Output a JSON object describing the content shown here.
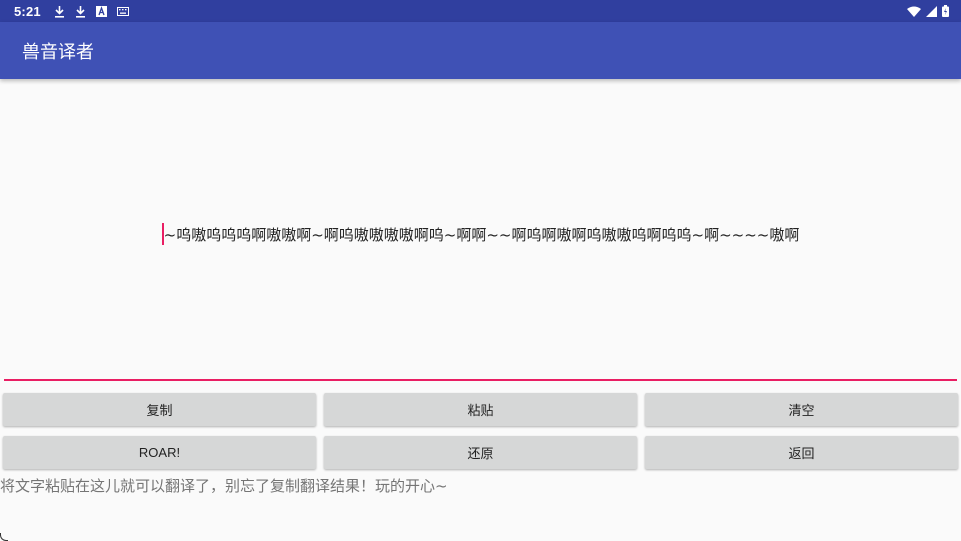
{
  "status_bar": {
    "time": "5:21",
    "left_icons": [
      "download-icon",
      "download-icon",
      "font-icon",
      "keyboard-icon"
    ],
    "right_icons": [
      "wifi-icon",
      "signal-icon",
      "battery-icon"
    ]
  },
  "app_bar": {
    "title": "兽音译者"
  },
  "editor": {
    "text": "~呜嗷呜呜呜啊嗷嗷啊~啊呜嗷嗷嗷嗷啊呜~啊啊~~啊呜啊嗷啊呜嗷嗷呜啊呜呜~啊~~~~嗷啊",
    "underline_color": "#e91e63"
  },
  "buttons": {
    "copy": "复制",
    "paste": "粘贴",
    "clear": "清空",
    "roar": "ROAR!",
    "restore": "还原",
    "back": "返回"
  },
  "hint": "将文字粘贴在这儿就可以翻译了，别忘了复制翻译结果！玩的开心~",
  "colors": {
    "status_bar": "#303f9f",
    "app_bar": "#3f51b5",
    "accent": "#e91e63",
    "button": "#d6d7d7"
  }
}
